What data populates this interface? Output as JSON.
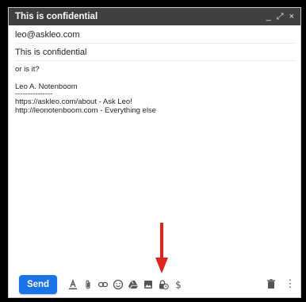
{
  "window": {
    "title": "This is confidential"
  },
  "controls": {
    "minimize_glyph": "_",
    "expand_glyph": "⤢",
    "close_glyph": "×"
  },
  "compose": {
    "to": "leo@askleo.com",
    "subject": "This is confidential",
    "body_lines": [
      "or is it?",
      "",
      "Leo A. Notenboom",
      "---------------",
      "https://askleo.com/about - Ask Leo!",
      "http://leonotenboom.com - Everything else"
    ]
  },
  "toolbar": {
    "send_label": "Send",
    "icons": [
      "format-text-icon",
      "attach-icon",
      "link-icon",
      "emoji-icon",
      "drive-icon",
      "photo-icon",
      "confidential-mode-icon",
      "dollar-icon"
    ],
    "more_glyph": "⋮"
  },
  "annotation": {
    "arrow_color": "#e0261c",
    "send_color": "#1a73e8",
    "titlebar_color": "#404040"
  }
}
